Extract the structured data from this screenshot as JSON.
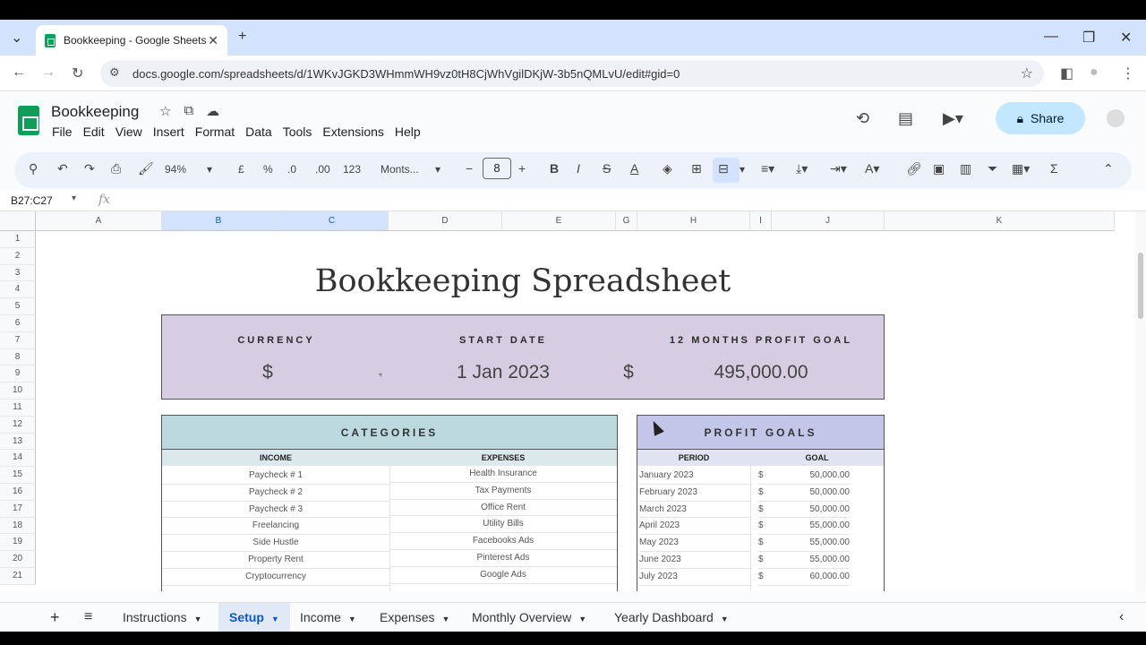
{
  "browser": {
    "tab_title": "Bookkeeping - Google Sheets",
    "url": "docs.google.com/spreadsheets/d/1WKvJGKD3WHmmWH9vz0tH8CjWhVgilDKjW-3b5nQMLvU/edit#gid=0"
  },
  "doc": {
    "title": "Bookkeeping",
    "menu": [
      "File",
      "Edit",
      "View",
      "Insert",
      "Format",
      "Data",
      "Tools",
      "Extensions",
      "Help"
    ],
    "share_label": "Share"
  },
  "toolbar": {
    "zoom": "94%",
    "currency": "£",
    "percent": "%",
    "dec_decrease": ".0",
    "dec_increase": ".00",
    "number_format": "123",
    "font": "Monts...",
    "font_size": "8"
  },
  "formula": {
    "namebox": "B27:C27",
    "fx": "fx"
  },
  "columns": [
    "A",
    "B",
    "C",
    "D",
    "E",
    "G",
    "H",
    "I",
    "J",
    "K"
  ],
  "rows": [
    "1",
    "2",
    "3",
    "4",
    "5",
    "6",
    "7",
    "8",
    "9",
    "10",
    "11",
    "12",
    "13",
    "14",
    "15",
    "16",
    "17",
    "18",
    "19",
    "20",
    "21"
  ],
  "sheet": {
    "title": "Bookkeeping Spreadsheet",
    "setup": {
      "currency_label": "CURRENCY",
      "currency_value": "$",
      "start_label": "START DATE",
      "start_value": "1 Jan 2023",
      "goal_label": "12 MONTHS PROFIT GOAL",
      "goal_currency": "$",
      "goal_value": "495,000.00"
    },
    "categories": {
      "title": "CATEGORIES",
      "income_header": "INCOME",
      "expenses_header": "EXPENSES",
      "income": [
        "Paycheck # 1",
        "Paycheck # 2",
        "Paycheck # 3",
        "Freelancing",
        "Side Hustle",
        "Property Rent",
        "Cryptocurrency"
      ],
      "expenses": [
        "Health Insurance",
        "Tax Payments",
        "Office Rent",
        "Utility Bills",
        "Facebooks Ads",
        "Pinterest Ads",
        "Google Ads"
      ]
    },
    "profit_goals": {
      "title": "PROFIT GOALS",
      "period_header": "PERIOD",
      "goal_header": "GOAL",
      "rows": [
        {
          "period": "January 2023",
          "cur": "$",
          "goal": "50,000.00"
        },
        {
          "period": "February 2023",
          "cur": "$",
          "goal": "50,000.00"
        },
        {
          "period": "March 2023",
          "cur": "$",
          "goal": "50,000.00"
        },
        {
          "period": "April 2023",
          "cur": "$",
          "goal": "55,000.00"
        },
        {
          "period": "May 2023",
          "cur": "$",
          "goal": "55,000.00"
        },
        {
          "period": "June 2023",
          "cur": "$",
          "goal": "55,000.00"
        },
        {
          "period": "July 2023",
          "cur": "$",
          "goal": "60,000.00"
        }
      ]
    }
  },
  "sheet_tabs": [
    "Instructions",
    "Setup",
    "Income",
    "Expenses",
    "Monthly Overview",
    "Yearly Dashboard"
  ],
  "colors": {
    "setup_bg": "#d6cde2",
    "categories_header": "#bcd9e0",
    "profit_header": "#c4c6e9",
    "active_tab": "#0b57d0"
  }
}
